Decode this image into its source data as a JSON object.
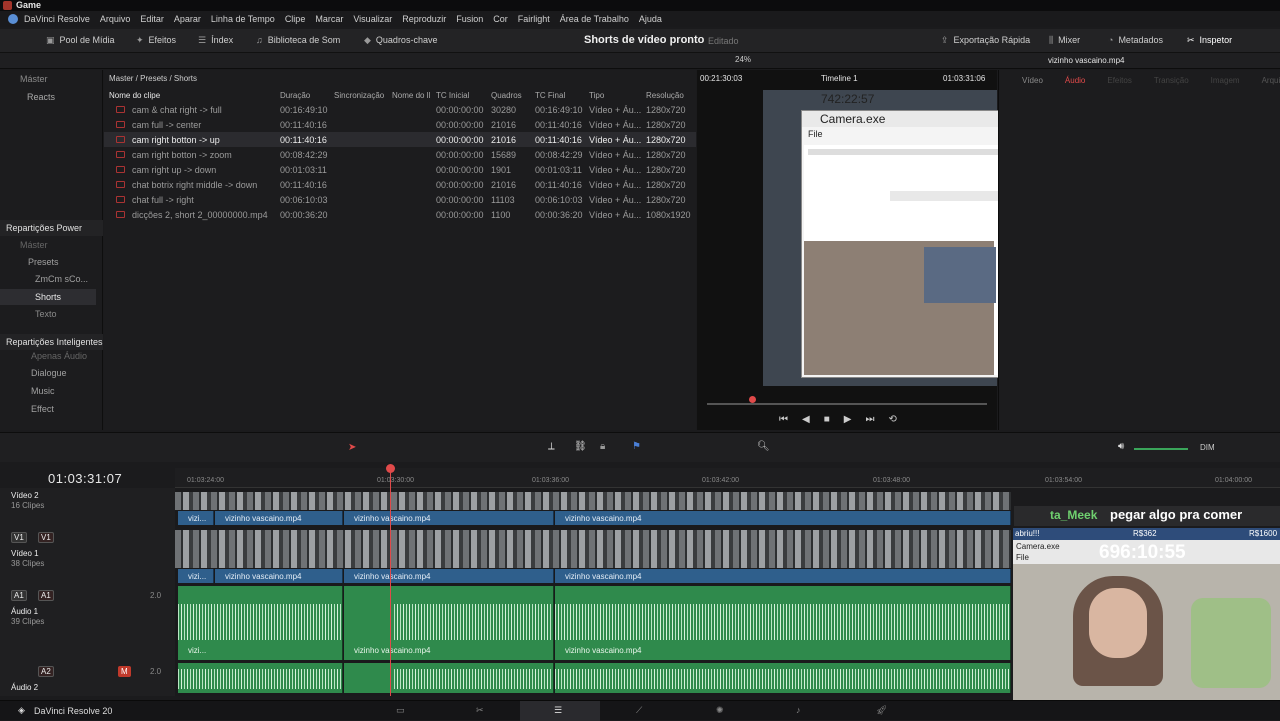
{
  "window": {
    "title": "Game"
  },
  "menu": [
    "DaVinci Resolve",
    "Arquivo",
    "Editar",
    "Aparar",
    "Linha de Tempo",
    "Clipe",
    "Marcar",
    "Visualizar",
    "Reproduzir",
    "Fusion",
    "Cor",
    "Fairlight",
    "Área de Trabalho",
    "Ajuda"
  ],
  "toolbar": {
    "media_pool": "Pool de Mídia",
    "effects": "Efeitos",
    "index": "Índex",
    "sound_library": "Biblioteca de Som",
    "keyframes": "Quadros-chave",
    "project_title": "Shorts de vídeo pronto",
    "project_status": "Editado",
    "quick_export": "Exportação Rápida",
    "mixer": "Mixer",
    "metadata": "Metadados",
    "inspector": "Inspetor"
  },
  "subbar": {
    "zoom": "24%",
    "source_tc": "00:21:30:03",
    "timeline_name": "Timeline 1",
    "record_tc": "01:03:31:06",
    "clip_name": "vizinho vascaino.mp4"
  },
  "bins": {
    "master": "Máster",
    "reacts": "Reacts",
    "power_title": "Repartições Power",
    "power_items": [
      "Máster",
      "Presets",
      "ZmCm sCo...",
      "Shorts",
      "Texto"
    ],
    "smart_title": "Repartições Inteligentes",
    "smart_items": [
      "Apenas Áudio",
      "Dialogue",
      "Music",
      "Effect"
    ]
  },
  "breadcrumb": "Master / Presets / Shorts",
  "columns": [
    "Nome do clipe",
    "Duração",
    "Sincronização",
    "Nome do ll",
    "TC Inicial",
    "Quadros",
    "TC Final",
    "Tipo",
    "Resolução"
  ],
  "clips": [
    {
      "name": "cam & chat right -> full",
      "dur": "00:16:49:10",
      "start": "00:00:00:00",
      "frames": "30280",
      "end": "00:16:49:10",
      "type": "Vídeo + Áu...",
      "res": "1280x720"
    },
    {
      "name": "cam full -> center",
      "dur": "00:11:40:16",
      "start": "00:00:00:00",
      "frames": "21016",
      "end": "00:11:40:16",
      "type": "Vídeo + Áu...",
      "res": "1280x720"
    },
    {
      "name": "cam right botton -> up",
      "dur": "00:11:40:16",
      "start": "00:00:00:00",
      "frames": "21016",
      "end": "00:11:40:16",
      "type": "Vídeo + Áu...",
      "res": "1280x720"
    },
    {
      "name": "cam right botton -> zoom",
      "dur": "00:08:42:29",
      "start": "00:00:00:00",
      "frames": "15689",
      "end": "00:08:42:29",
      "type": "Vídeo + Áu...",
      "res": "1280x720"
    },
    {
      "name": "cam right up -> down",
      "dur": "00:01:03:11",
      "start": "00:00:00:00",
      "frames": "1901",
      "end": "00:01:03:11",
      "type": "Vídeo + Áu...",
      "res": "1280x720"
    },
    {
      "name": "chat botrix right middle -> down",
      "dur": "00:11:40:16",
      "start": "00:00:00:00",
      "frames": "21016",
      "end": "00:11:40:16",
      "type": "Vídeo + Áu...",
      "res": "1280x720"
    },
    {
      "name": "chat full -> right",
      "dur": "00:06:10:03",
      "start": "00:00:00:00",
      "frames": "11103",
      "end": "00:06:10:03",
      "type": "Vídeo + Áu...",
      "res": "1280x720"
    },
    {
      "name": "dicções 2, short 2_00000000.mp4",
      "dur": "00:00:36:20",
      "start": "00:00:00:00",
      "frames": "1100",
      "end": "00:00:36:20",
      "type": "Vídeo + Áu...",
      "res": "1080x1920"
    }
  ],
  "inspector_tabs": [
    "Vídeo",
    "Áudio",
    "Efeitos",
    "Transição",
    "Imagem",
    "Arquivo"
  ],
  "viewer": {
    "overlay_counter": "742:22:57",
    "cam_title": "Camera.exe",
    "cam_menu": "File"
  },
  "timeline": {
    "timecode": "01:03:31:07",
    "ruler": [
      "01:03:24:00",
      "01:03:30:00",
      "01:03:36:00",
      "01:03:42:00",
      "01:03:48:00",
      "01:03:54:00",
      "01:04:00:00"
    ],
    "tracks": {
      "v2": {
        "name": "Vídeo 2",
        "count": "16 Clipes"
      },
      "v1": {
        "name": "Vídeo 1",
        "count": "38 Clipes",
        "tag": "V1"
      },
      "a1": {
        "name": "Áudio 1",
        "count": "39 Clipes",
        "tag": "A1",
        "level": "2.0"
      },
      "a2": {
        "name": "Áudio 2",
        "tag": "A2",
        "level": "2.0"
      }
    },
    "clip_short": "vizi...",
    "clip_name": "vizinho vascaino.mp4",
    "dim": "DIM"
  },
  "overlay": {
    "chat_user": "ta_Meek",
    "chat_msg": "pegar algo pra comer",
    "stream_label": "abriu!!!",
    "money1": "R$362",
    "money2": "R$1600",
    "counter": "696:10:55",
    "cam_title": "Camera.exe",
    "cam_menu": "File"
  },
  "bottom": {
    "app": "DaVinci Resolve 20"
  }
}
